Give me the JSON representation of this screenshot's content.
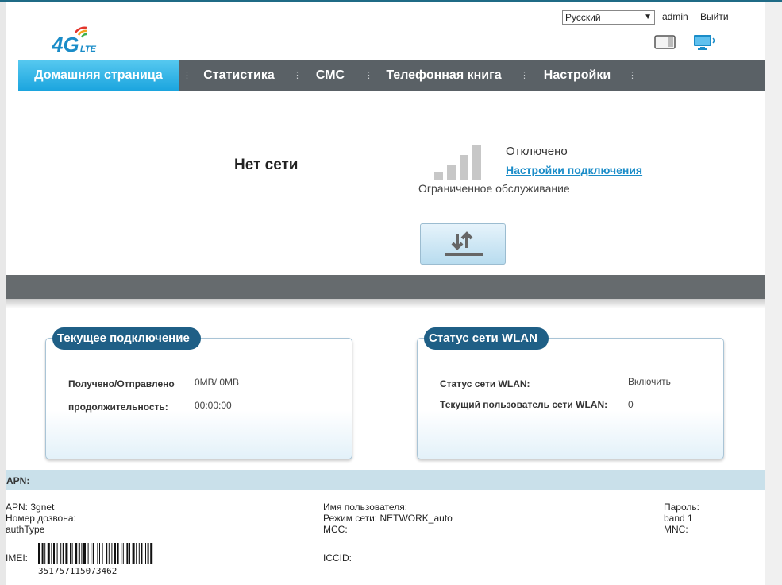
{
  "header": {
    "logo_text": "4G",
    "logo_sub": "LTE",
    "language_selected": "Русский",
    "user": "admin",
    "logout_label": "Выйти"
  },
  "nav": {
    "items": [
      {
        "label": "Домашняя страница",
        "active": true
      },
      {
        "label": "Статистика"
      },
      {
        "label": "СМС"
      },
      {
        "label": "Телефонная книга"
      },
      {
        "label": "Настройки"
      }
    ]
  },
  "status": {
    "network": "Нет сети",
    "connection_state": "Отключено",
    "connection_settings_link": "Настройки подключения",
    "service": "Ограниченное обслуживание"
  },
  "current_connection": {
    "title": "Текущее подключение",
    "received_sent_label": "Получено/Отправлено",
    "received_sent_value": "0MB/ 0MB",
    "duration_label": "продолжительность:",
    "duration_value": "00:00:00"
  },
  "wlan": {
    "title": "Статус сети WLAN",
    "status_label": "Статус сети WLAN:",
    "status_value": "Включить",
    "users_label": "Текущий пользователь сети WLAN:",
    "users_value": "0"
  },
  "apn": {
    "header": "APN:",
    "apn": "APN: 3gnet",
    "dial_number": "Номер дозвона:",
    "auth_type": "authType",
    "username": "Имя пользователя:",
    "network_mode": "Режим сети: NETWORK_auto",
    "mcc": "MCC:",
    "password": "Пароль:",
    "band": "band 1",
    "mnc": "MNC:",
    "imei_label": "IMEI:",
    "imei_value": "351757115073462",
    "iccid_label": "ICCID:"
  },
  "colors": {
    "nav_bg": "#5a6166",
    "nav_active": "#1aa4de",
    "panel_title": "#1f5f86",
    "link": "#1a8cc8"
  }
}
